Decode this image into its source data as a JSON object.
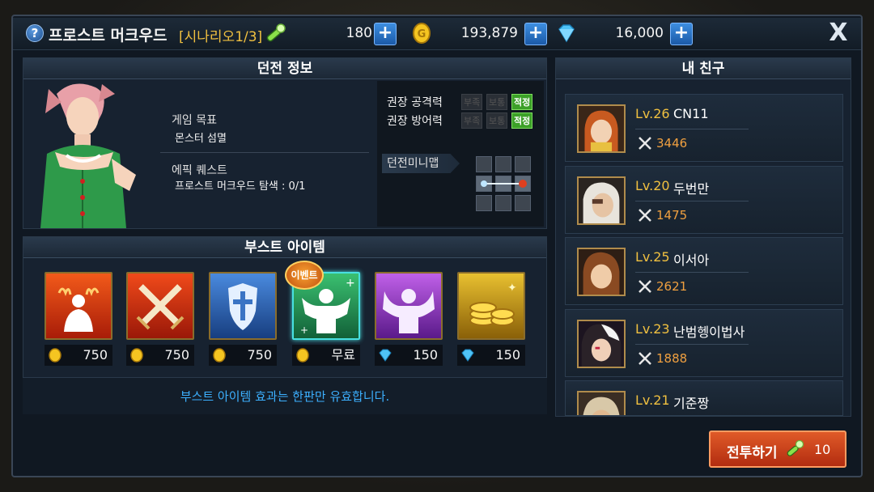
{
  "header": {
    "help_symbol": "?",
    "title": "프로스트 머크우드",
    "scenario": "[시나리오1/3]",
    "stamina": "180",
    "gold": "193,879",
    "gems": "16,000",
    "close_symbol": "X"
  },
  "dungeon": {
    "heading": "던전 정보",
    "goal_label": "게임 목표",
    "goal_value": "몬스터 섬멸",
    "quest_label": "에픽 퀘스트",
    "quest_value": "프로스트 머크우드 탐색 : 0/1",
    "atk_label": "권장 공격력",
    "def_label": "권장 방어력",
    "tags": [
      "부족",
      "보통",
      "적정"
    ],
    "minimap_label": "던전미니맵"
  },
  "boost": {
    "heading": "부스트 아이템",
    "event_badge": "이벤트",
    "items": [
      {
        "price": "750",
        "currency": "gold"
      },
      {
        "price": "750",
        "currency": "gold"
      },
      {
        "price": "750",
        "currency": "gold"
      },
      {
        "price": "무료",
        "currency": "gold"
      },
      {
        "price": "150",
        "currency": "gem"
      },
      {
        "price": "150",
        "currency": "gem"
      }
    ],
    "notice": "부스트 아이템 효과는 한판만 유효합니다."
  },
  "friends": {
    "heading": "내 친구",
    "list": [
      {
        "level": "Lv.26",
        "name": "CN11",
        "power": "3446"
      },
      {
        "level": "Lv.20",
        "name": "두번만",
        "power": "1475"
      },
      {
        "level": "Lv.25",
        "name": "이서아",
        "power": "2621"
      },
      {
        "level": "Lv.23",
        "name": "난범헹이법사",
        "power": "1888"
      },
      {
        "level": "Lv.21",
        "name": "기준짱",
        "power": ""
      }
    ]
  },
  "fight": {
    "label": "전투하기",
    "cost": "10"
  },
  "colors": {
    "accent_gold": "#f0c040",
    "power_orange": "#f0a040",
    "notice_blue": "#3cb0ff",
    "tag_green": "#3ca028",
    "fight_red": "#c03a18"
  }
}
